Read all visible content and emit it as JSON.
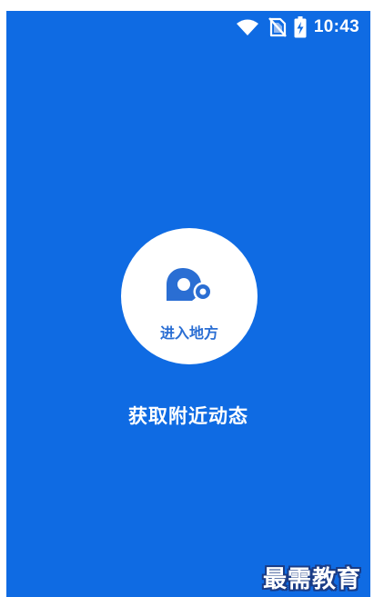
{
  "status_bar": {
    "time": "10:43",
    "icons": [
      "wifi-icon",
      "no-sim-icon",
      "battery-charging-icon"
    ]
  },
  "nearby_button": {
    "icon": "location-pin-icon",
    "label": "进入地方"
  },
  "subtitle": "获取附近动态",
  "watermark": "最需教育",
  "colors": {
    "background": "#0f6be3",
    "circle": "#ffffff",
    "accent_text": "#2a6ed3",
    "primary_text": "#ffffff"
  }
}
